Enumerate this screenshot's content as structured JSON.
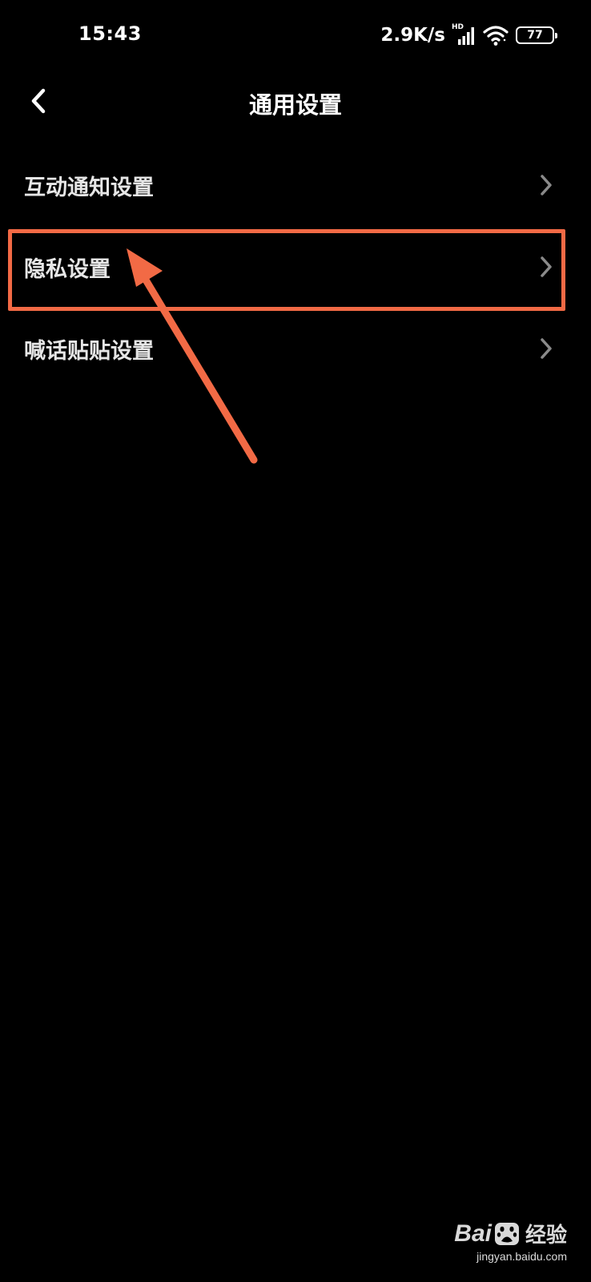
{
  "status_bar": {
    "time": "15:43",
    "net_speed": "2.9K/s",
    "hd_label": "HD",
    "battery": "77"
  },
  "header": {
    "title": "通用设置",
    "back_icon": "chevron-left-icon"
  },
  "settings": {
    "items": [
      {
        "label": "互动通知设置",
        "icon": "chevron-right-icon"
      },
      {
        "label": "隐私设置",
        "icon": "chevron-right-icon"
      },
      {
        "label": "喊话贴贴设置",
        "icon": "chevron-right-icon"
      }
    ]
  },
  "annotation": {
    "highlighted_item": "隐私设置",
    "color": "#f26a45"
  },
  "watermark": {
    "brand": "Bai",
    "brand_suffix": "经验",
    "url": "jingyan.baidu.com"
  }
}
